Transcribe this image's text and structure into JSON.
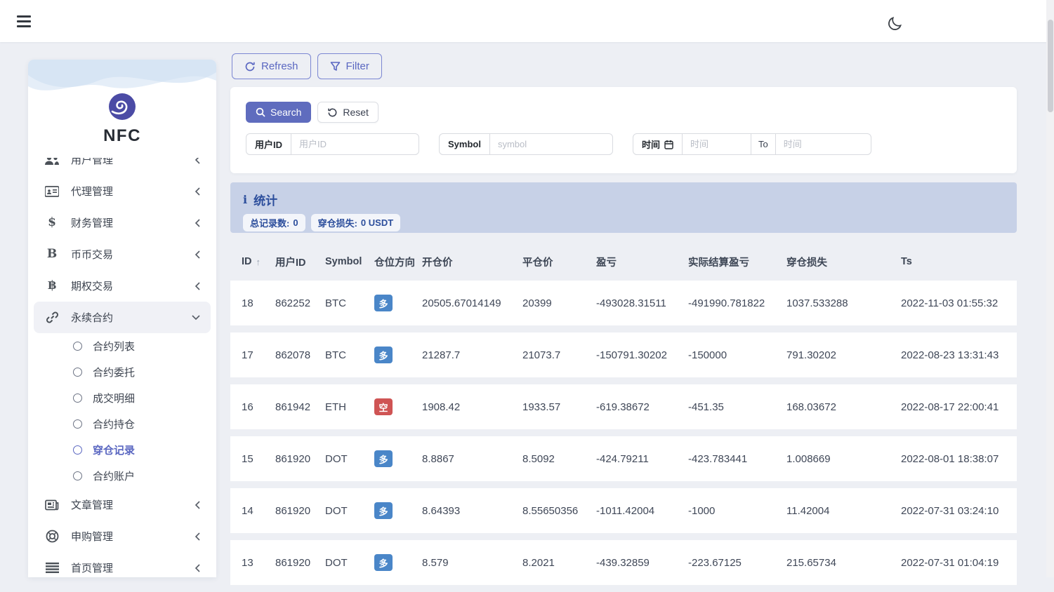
{
  "topbar": {
    "theme_icon": "moon"
  },
  "sidebar": {
    "logo_text": "NFC",
    "items": [
      {
        "label": "用户管理",
        "icon": "users-icon"
      },
      {
        "label": "代理管理",
        "icon": "id-card-icon"
      },
      {
        "label": "财务管理",
        "icon": "dollar-icon",
        "icon_glyph": "$"
      },
      {
        "label": "币币交易",
        "icon": "letter-b-icon",
        "icon_glyph": "B"
      },
      {
        "label": "期权交易",
        "icon": "bitcoin-icon",
        "icon_glyph": "฿"
      },
      {
        "label": "永续合约",
        "icon": "link-icon",
        "state": "expanded",
        "children": [
          "合约列表",
          "合约委托",
          "成交明细",
          "合约持仓",
          "穿仓记录",
          "合约账户"
        ],
        "active_child": "穿仓记录"
      },
      {
        "label": "文章管理",
        "icon": "newspaper-icon"
      },
      {
        "label": "申购管理",
        "icon": "life-ring-icon"
      },
      {
        "label": "首页管理",
        "icon": "lines-icon"
      }
    ]
  },
  "toolbar": {
    "refresh_label": "Refresh",
    "filter_label": "Filter"
  },
  "search_panel": {
    "search_label": "Search",
    "reset_label": "Reset",
    "fields": [
      {
        "label": "用户ID",
        "placeholder": "用户ID"
      },
      {
        "label": "Symbol",
        "placeholder": "symbol"
      },
      {
        "label": "时间",
        "placeholder_from": "时间",
        "to_label": "To",
        "placeholder_to": "时间"
      }
    ]
  },
  "stats": {
    "title": "统计",
    "badges": [
      {
        "label": "总记录数:",
        "value": "0"
      },
      {
        "label": "穿仓损失:",
        "value": "0 USDT"
      }
    ]
  },
  "table": {
    "columns": [
      "ID",
      "用户ID",
      "Symbol",
      "仓位方向",
      "开仓价",
      "平仓价",
      "盈亏",
      "实际结算盈亏",
      "穿仓损失",
      "Ts"
    ],
    "rows": [
      {
        "id": "18",
        "user_id": "862252",
        "symbol": "BTC",
        "direction": "多",
        "direction_type": "long",
        "open_price": "20505.67014149",
        "close_price": "20399",
        "pnl": "-493028.31511",
        "settled_pnl": "-491990.781822",
        "liq_loss": "1037.533288",
        "ts": "2022-11-03 01:55:32"
      },
      {
        "id": "17",
        "user_id": "862078",
        "symbol": "BTC",
        "direction": "多",
        "direction_type": "long",
        "open_price": "21287.7",
        "close_price": "21073.7",
        "pnl": "-150791.30202",
        "settled_pnl": "-150000",
        "liq_loss": "791.30202",
        "ts": "2022-08-23 13:31:43"
      },
      {
        "id": "16",
        "user_id": "861942",
        "symbol": "ETH",
        "direction": "空",
        "direction_type": "short",
        "open_price": "1908.42",
        "close_price": "1933.57",
        "pnl": "-619.38672",
        "settled_pnl": "-451.35",
        "liq_loss": "168.03672",
        "ts": "2022-08-17 22:00:41"
      },
      {
        "id": "15",
        "user_id": "861920",
        "symbol": "DOT",
        "direction": "多",
        "direction_type": "long",
        "open_price": "8.8867",
        "close_price": "8.5092",
        "pnl": "-424.79211",
        "settled_pnl": "-423.783441",
        "liq_loss": "1.008669",
        "ts": "2022-08-01 18:38:07"
      },
      {
        "id": "14",
        "user_id": "861920",
        "symbol": "DOT",
        "direction": "多",
        "direction_type": "long",
        "open_price": "8.64393",
        "close_price": "8.55650356",
        "pnl": "-1011.42004",
        "settled_pnl": "-1000",
        "liq_loss": "11.42004",
        "ts": "2022-07-31 03:24:10"
      },
      {
        "id": "13",
        "user_id": "861920",
        "symbol": "DOT",
        "direction": "多",
        "direction_type": "long",
        "open_price": "8.579",
        "close_price": "8.2021",
        "pnl": "-439.32859",
        "settled_pnl": "-223.67125",
        "liq_loss": "215.65734",
        "ts": "2022-07-31 01:04:19"
      }
    ]
  },
  "colors": {
    "accent_purple": "#5a67c1",
    "long_badge": "#4a86c8",
    "short_badge": "#cf5454",
    "stats_bg": "#c7d1e7",
    "stats_text": "#2c4e9c"
  }
}
